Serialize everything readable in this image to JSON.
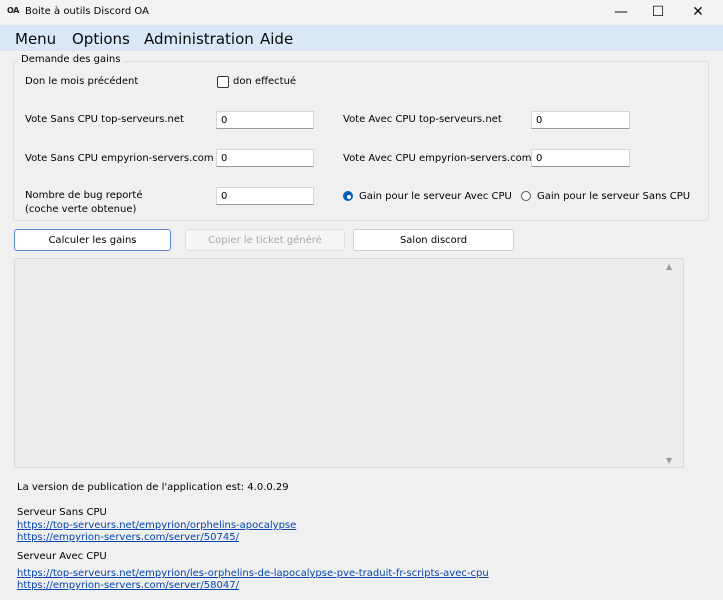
{
  "window": {
    "title": "Boite à outils Discord OA",
    "icon_text": "OA",
    "minimize": "—",
    "maximize": "☐",
    "close": "✕"
  },
  "menubar": {
    "items": [
      {
        "label": "Menu"
      },
      {
        "label": "Options"
      },
      {
        "label": "Administration"
      },
      {
        "label": "Aide"
      }
    ]
  },
  "group": {
    "title": "Demande des gains",
    "don_label": "Don le mois précédent",
    "don_checkbox_label": "don effectué",
    "don_checked": false,
    "vote_sans_cpu_top_label": "Vote Sans CPU top-serveurs.net",
    "vote_sans_cpu_top_value": "0",
    "vote_sans_cpu_emp_label": "Vote Sans CPU empyrion-servers.com",
    "vote_sans_cpu_emp_value": "0",
    "bug_label_line1": "Nombre de bug reporté",
    "bug_label_line2": "(coche verte obtenue)",
    "bug_value": "0",
    "vote_avec_cpu_top_label": "Vote Avec CPU top-serveurs.net",
    "vote_avec_cpu_top_value": "0",
    "vote_avec_cpu_emp_label": "Vote Avec CPU empyrion-servers.com",
    "vote_avec_cpu_emp_value": "0",
    "radio_avec_label": "Gain pour le serveur Avec CPU",
    "radio_sans_label": "Gain pour le serveur Sans CPU",
    "selected_radio": "avec"
  },
  "buttons": {
    "calc": "Calculer les gains",
    "copy": "Copier le ticket généré",
    "discord": "Salon discord"
  },
  "output": {
    "text": "",
    "scroll_up": "▲",
    "scroll_down": "▼"
  },
  "footer": {
    "version": "La version de publication de l'application est: 4.0.0.29",
    "sans_cpu_title": "Serveur Sans CPU",
    "sans_cpu_link1": "https://top-serveurs.net/empyrion/orphelins-apocalypse",
    "sans_cpu_link2": "https://empyrion-servers.com/server/50745/",
    "avec_cpu_title": "Serveur Avec CPU",
    "avec_cpu_link1": "https://top-serveurs.net/empyrion/les-orphelins-de-lapocalypse-pve-traduit-fr-scripts-avec-cpu",
    "avec_cpu_link2": "https://empyrion-servers.com/server/58047/"
  }
}
